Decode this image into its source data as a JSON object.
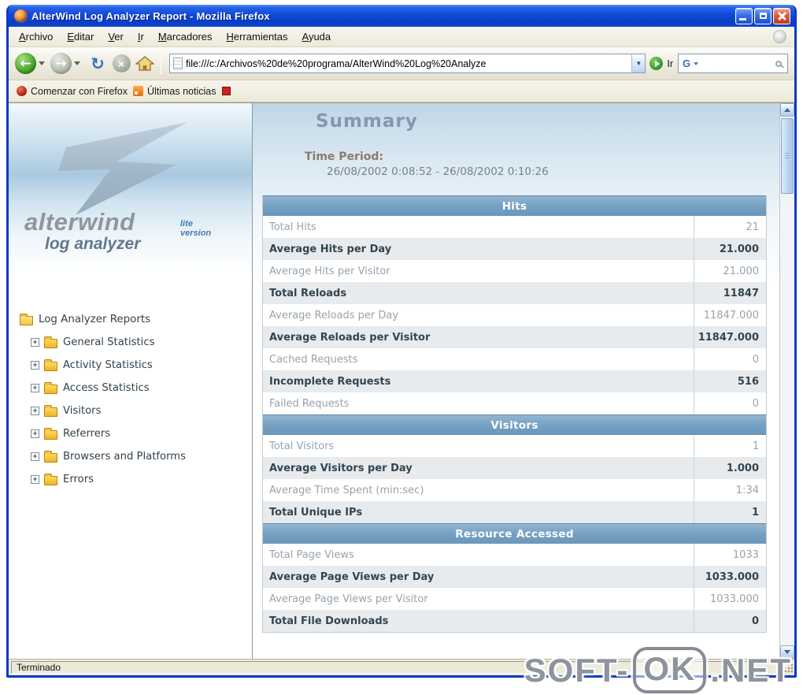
{
  "window": {
    "title": "AlterWind Log Analyzer Report - Mozilla Firefox"
  },
  "menubar": {
    "items": [
      "Archivo",
      "Editar",
      "Ver",
      "Ir",
      "Marcadores",
      "Herramientas",
      "Ayuda"
    ]
  },
  "toolbar": {
    "address_value": "file:///c:/Archivos%20de%20programa/AlterWind%20Log%20Analyze",
    "go_label": "Ir",
    "search_logo": "G"
  },
  "glyphs": {
    "back": "←",
    "forward": "→",
    "reload": "↻",
    "stop": "×",
    "dropdown": "▼",
    "plus": "+"
  },
  "bookmarks": {
    "start_label": "Comenzar con Firefox",
    "news_label": "Últimas noticias"
  },
  "sidebar": {
    "logo": {
      "brand": "alterwind",
      "product": "log analyzer",
      "edition": "lite version"
    },
    "tree": [
      {
        "label": "Log Analyzer Reports",
        "root": true
      },
      {
        "label": "General Statistics"
      },
      {
        "label": "Activity Statistics"
      },
      {
        "label": "Access Statistics"
      },
      {
        "label": "Visitors"
      },
      {
        "label": "Referrers"
      },
      {
        "label": "Browsers and Platforms"
      },
      {
        "label": "Errors"
      }
    ]
  },
  "report": {
    "title": "Summary",
    "time_period_label": "Time Period:",
    "time_period_value": "26/08/2002 0:08:52 - 26/08/2002 0:10:26",
    "sections": [
      {
        "header": "Hits",
        "rows": [
          {
            "label": "Total Hits",
            "value": "21"
          },
          {
            "label": "Average Hits per Day",
            "value": "21.000"
          },
          {
            "label": "Average Hits per Visitor",
            "value": "21.000"
          },
          {
            "label": "Total Reloads",
            "value": "11847"
          },
          {
            "label": "Average Reloads per Day",
            "value": "11847.000"
          },
          {
            "label": "Average Reloads per Visitor",
            "value": "11847.000"
          },
          {
            "label": "Cached Requests",
            "value": "0"
          },
          {
            "label": "Incomplete Requests",
            "value": "516"
          },
          {
            "label": "Failed Requests",
            "value": "0"
          }
        ]
      },
      {
        "header": "Visitors",
        "rows": [
          {
            "label": "Total Visitors",
            "value": "1"
          },
          {
            "label": "Average Visitors per Day",
            "value": "1.000"
          },
          {
            "label": "Average Time Spent (min:sec)",
            "value": "1:34"
          },
          {
            "label": "Total Unique IPs",
            "value": "1"
          }
        ]
      },
      {
        "header": "Resource Accessed",
        "rows": [
          {
            "label": "Total Page Views",
            "value": "1033"
          },
          {
            "label": "Average Page Views per Day",
            "value": "1033.000"
          },
          {
            "label": "Average Page Views per Visitor",
            "value": "1033.000"
          },
          {
            "label": "Total File Downloads",
            "value": "0"
          }
        ]
      }
    ]
  },
  "statusbar": {
    "text": "Terminado"
  },
  "watermark": {
    "part1": "SOFT-",
    "part2": "OK",
    "part3": ".NET"
  },
  "colors": {
    "titlebar_blue": "#1c53d8",
    "section_header_bg": "#7da4c5",
    "row_shaded_bg": "#e7ebee",
    "dim_text": "#98a3ac",
    "strong_text": "#35444f",
    "back_green": "#4aa32e"
  }
}
